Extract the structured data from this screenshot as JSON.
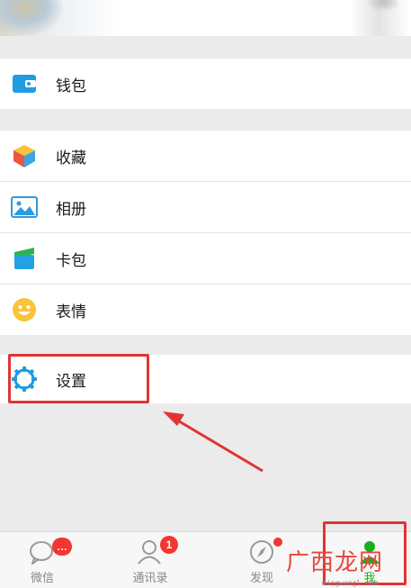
{
  "menu": {
    "wallet": {
      "label": "钱包",
      "icon": "wallet-icon"
    },
    "favorites": {
      "label": "收藏",
      "icon": "favorites-cube-icon"
    },
    "album": {
      "label": "相册",
      "icon": "album-picture-icon"
    },
    "cards": {
      "label": "卡包",
      "icon": "card-pack-icon"
    },
    "stickers": {
      "label": "表情",
      "icon": "smiley-icon"
    },
    "settings": {
      "label": "设置",
      "icon": "gear-icon"
    }
  },
  "tabbar": {
    "chats": {
      "label": "微信",
      "badge": "…",
      "icon": "chat-bubble-icon"
    },
    "contacts": {
      "label": "通讯录",
      "badge": "1",
      "icon": "contacts-icon"
    },
    "discover": {
      "label": "发现",
      "icon": "compass-icon"
    },
    "me": {
      "label": "我",
      "icon": "person-icon",
      "active": true
    }
  },
  "watermark": {
    "text": "广西龙网",
    "url": "mingwangl.com"
  },
  "colors": {
    "accent_green": "#1aad19",
    "highlight_red": "#e03434",
    "badge_red": "#f43530",
    "settings_blue": "#1e9be0"
  }
}
